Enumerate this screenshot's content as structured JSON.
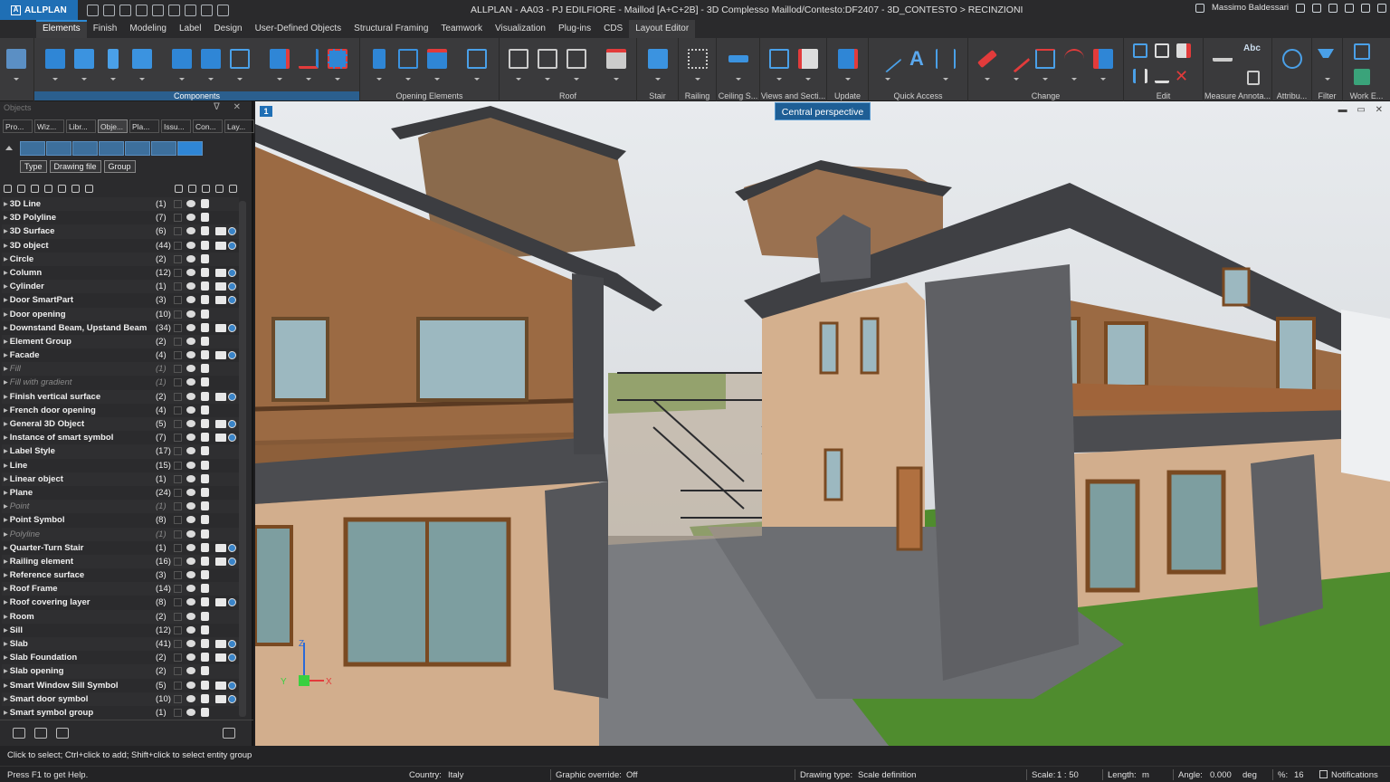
{
  "app": {
    "name": "ALLPLAN",
    "title": "ALLPLAN - AA03 - PJ EDILFIORE - Maillod [A+C+2B] - 3D Complesso Maillod/Contesto:DF2407 - 3D_CONTESTO > RECINZIONI",
    "user": "Massimo Baldessari"
  },
  "tabs": [
    "Elements",
    "Finish",
    "Modeling",
    "Label",
    "Design",
    "User-Defined Objects",
    "Structural Framing",
    "Teamwork",
    "Visualization",
    "Plug-ins",
    "CDS",
    "Layout Editor"
  ],
  "ribbon_groups": [
    "Components",
    "Opening Elements",
    "Roof",
    "Stair",
    "Railing",
    "Ceiling S...",
    "Views and Secti...",
    "Update",
    "Quick Access",
    "Change",
    "Edit",
    "Measure Annota...",
    "Attribu...",
    "Filter",
    "Work E..."
  ],
  "ribbon_text": {
    "font_btn": "A",
    "abc": "Abc"
  },
  "tooltip": "Central perspective",
  "panel": {
    "title": "Objects",
    "tabs": [
      "Pro...",
      "Wiz...",
      "Libr...",
      "Obje...",
      "Pla...",
      "Issu...",
      "Con...",
      "Lay..."
    ],
    "filters": [
      "Type",
      "Drawing file",
      "Group"
    ],
    "rows": [
      {
        "name": "3D Line",
        "count": "(1)"
      },
      {
        "name": "3D Polyline",
        "count": "(7)"
      },
      {
        "name": "3D Surface",
        "count": "(6)"
      },
      {
        "name": "3D object",
        "count": "(44)"
      },
      {
        "name": "Circle",
        "count": "(2)"
      },
      {
        "name": "Column",
        "count": "(12)"
      },
      {
        "name": "Cylinder",
        "count": "(1)"
      },
      {
        "name": "Door SmartPart",
        "count": "(3)"
      },
      {
        "name": "Door opening",
        "count": "(10)"
      },
      {
        "name": "Downstand Beam, Upstand Beam",
        "count": "(34)"
      },
      {
        "name": "Element Group",
        "count": "(2)"
      },
      {
        "name": "Facade",
        "count": "(4)"
      },
      {
        "name": "Fill",
        "count": "(1)"
      },
      {
        "name": "Fill with gradient",
        "count": "(1)"
      },
      {
        "name": "Finish vertical surface",
        "count": "(2)"
      },
      {
        "name": "French door opening",
        "count": "(4)"
      },
      {
        "name": "General 3D Object",
        "count": "(5)"
      },
      {
        "name": "Instance of smart symbol",
        "count": "(7)"
      },
      {
        "name": "Label Style",
        "count": "(17)"
      },
      {
        "name": "Line",
        "count": "(15)"
      },
      {
        "name": "Linear object",
        "count": "(1)"
      },
      {
        "name": "Plane",
        "count": "(24)"
      },
      {
        "name": "Point",
        "count": "(1)"
      },
      {
        "name": "Point Symbol",
        "count": "(8)"
      },
      {
        "name": "Polyline",
        "count": "(1)"
      },
      {
        "name": "Quarter-Turn Stair",
        "count": "(1)"
      },
      {
        "name": "Railing element",
        "count": "(16)"
      },
      {
        "name": "Reference surface",
        "count": "(3)"
      },
      {
        "name": "Roof Frame",
        "count": "(14)"
      },
      {
        "name": "Roof covering layer",
        "count": "(8)"
      },
      {
        "name": "Room",
        "count": "(2)"
      },
      {
        "name": "Sill",
        "count": "(12)"
      },
      {
        "name": "Slab",
        "count": "(41)"
      },
      {
        "name": "Slab Foundation",
        "count": "(2)"
      },
      {
        "name": "Slab opening",
        "count": "(2)"
      },
      {
        "name": "Smart Window Sill Symbol",
        "count": "(5)"
      },
      {
        "name": "Smart door symbol",
        "count": "(10)"
      },
      {
        "name": "Smart symbol group",
        "count": "(1)"
      }
    ]
  },
  "axes": {
    "x": "X",
    "y": "Y",
    "z": "Z"
  },
  "status": {
    "hint": "Click to select; Ctrl+click to add; Shift+click to select entity group",
    "help": "Press F1 to get Help.",
    "country_label": "Country:",
    "country": "Italy",
    "graphic_label": "Graphic override:",
    "graphic": "Off",
    "drawing_label": "Drawing type:",
    "drawing": "Scale definition",
    "scale_label": "Scale:",
    "scale": "1 : 50",
    "length_label": "Length:",
    "length": "m",
    "angle_label": "Angle:",
    "angle": "0.000",
    "angle_unit": "deg",
    "percent_label": "%:",
    "percent": "16",
    "notifications": "Notifications"
  }
}
